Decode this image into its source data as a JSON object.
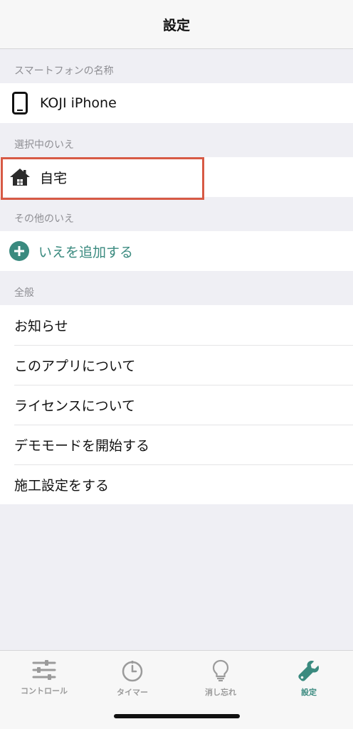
{
  "navbar": {
    "title": "設定"
  },
  "sections": {
    "phone_name": {
      "header": "スマートフォンの名称",
      "device_name": "KOJI iPhone"
    },
    "selected_home": {
      "header": "選択中のいえ",
      "home_name": "自宅"
    },
    "other_homes": {
      "header": "その他のいえ",
      "add_label": "いえを追加する"
    },
    "general": {
      "header": "全般",
      "items": [
        {
          "label": "お知らせ"
        },
        {
          "label": "このアプリについて"
        },
        {
          "label": "ライセンスについて"
        },
        {
          "label": "デモモードを開始する"
        },
        {
          "label": "施工設定をする"
        }
      ]
    }
  },
  "tabbar": {
    "tabs": [
      {
        "label": "コントロール",
        "icon": "sliders-icon"
      },
      {
        "label": "タイマー",
        "icon": "timer-icon"
      },
      {
        "label": "消し忘れ",
        "icon": "lightbulb-icon"
      },
      {
        "label": "設定",
        "icon": "wrench-icon"
      }
    ],
    "active_index": 3
  },
  "colors": {
    "accent": "#3a8a7f",
    "highlight": "#d75a45",
    "background": "#efeff4",
    "inactive_tab": "#9b9b9b"
  }
}
